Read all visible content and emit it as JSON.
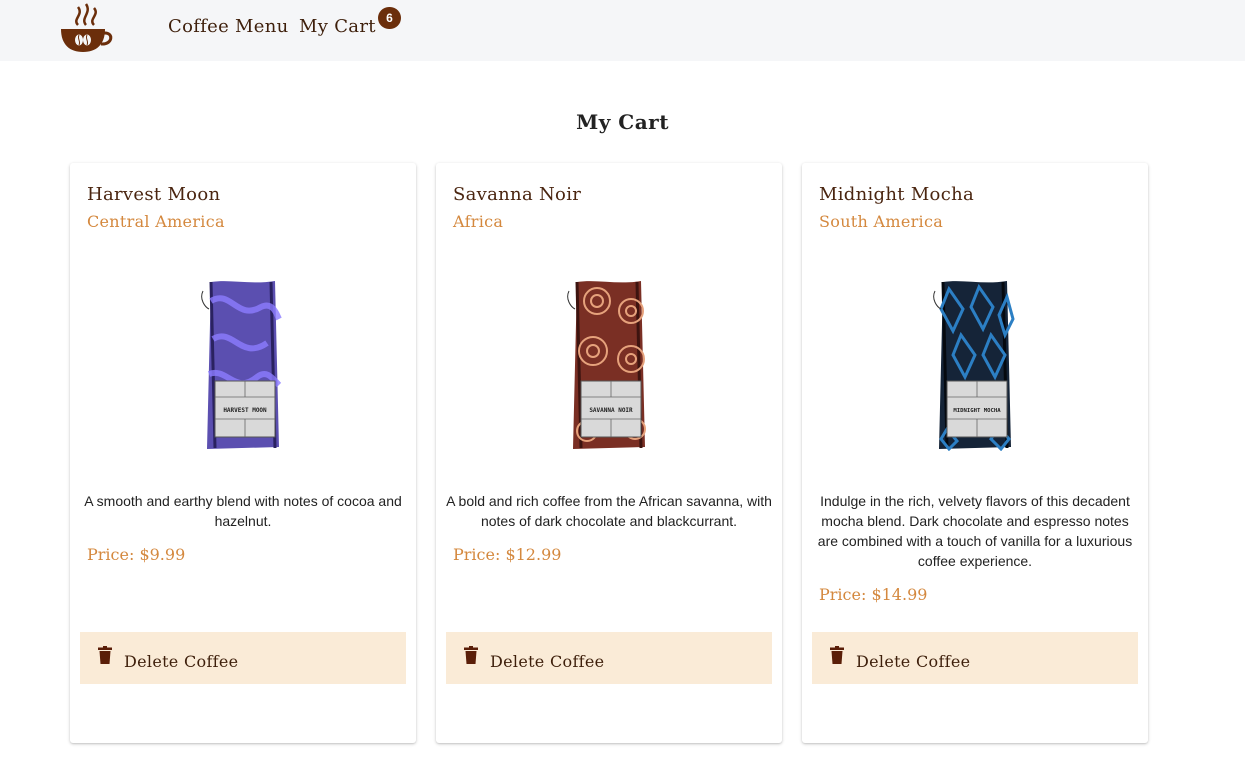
{
  "nav": {
    "logo_icon": "coffee-cup-logo-icon",
    "menu_label": "Coffee Menu",
    "cart_label": "My Cart",
    "cart_count": "6"
  },
  "page": {
    "title": "My Cart"
  },
  "cart_items": [
    {
      "name": "Harvest Moon",
      "origin": "Central America",
      "description": "A smooth and earthy blend with notes of cocoa and hazelnut.",
      "price": "Price: $9.99",
      "bag_label": "Harvest Moon",
      "bag_color": "#5b4fb0",
      "delete_label": "Delete Coffee"
    },
    {
      "name": "Savanna Noir",
      "origin": "Africa",
      "description": "A bold and rich coffee from the African savanna, with notes of dark chocolate and blackcurrant.",
      "price": "Price: $12.99",
      "bag_label": "Savanna Noir",
      "bag_color": "#7a2f24",
      "delete_label": "Delete Coffee"
    },
    {
      "name": "Midnight Mocha",
      "origin": "South America",
      "description": "Indulge in the rich, velvety flavors of this decadent mocha blend. Dark chocolate and espresso notes are combined with a touch of vanilla for a luxurious coffee experience.",
      "price": "Price: $14.99",
      "bag_label": "Midnight Mocha",
      "bag_color": "#152438",
      "delete_label": "Delete Coffee"
    }
  ],
  "colors": {
    "brand_dark": "#3e1f0b",
    "accent": "#d4883e",
    "delete_bg": "#faebd7",
    "badge": "#6b2e0b"
  }
}
